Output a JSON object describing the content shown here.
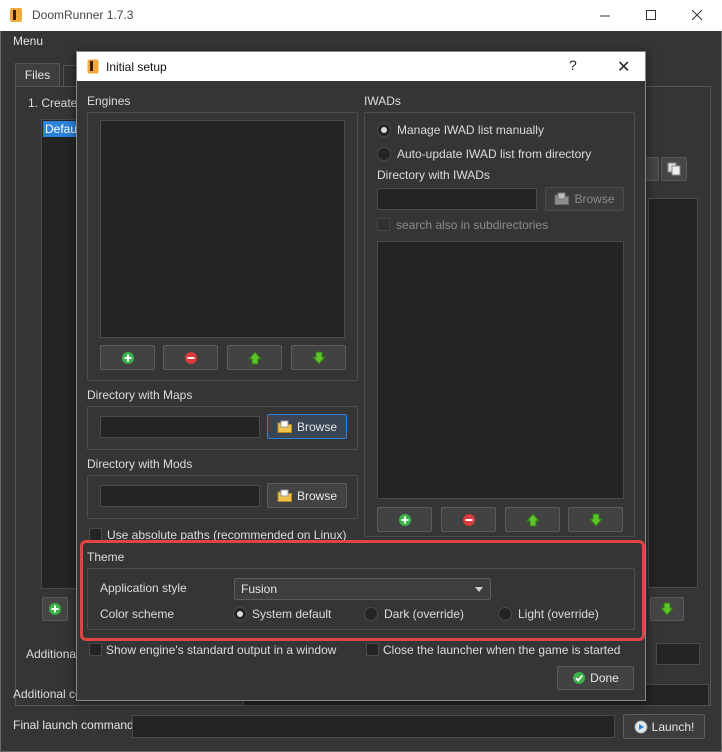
{
  "main_window": {
    "title": "DoomRunner 1.7.3",
    "menu_label": "Menu",
    "tabs": [
      {
        "label": "Files"
      },
      {
        "label": ""
      }
    ],
    "create_label": "1. Create",
    "preset_selected": "Defau",
    "additional_label_1": "Additional",
    "additional_label_2": "Additional co",
    "final_launch_label": "Final launch command",
    "final_launch_value": "",
    "launch_button": "Launch!"
  },
  "dialog": {
    "title": "Initial setup",
    "help_glyph": "?",
    "close_glyph": "✕",
    "engines": {
      "label": "Engines"
    },
    "maps_dir": {
      "label": "Directory with Maps",
      "value": "",
      "browse": "Browse"
    },
    "mods_dir": {
      "label": "Directory with Mods",
      "value": "",
      "browse": "Browse"
    },
    "absolute_paths": {
      "label": "Use absolute paths (recommended on Linux)",
      "checked": false
    },
    "iwads": {
      "label": "IWADs",
      "manual_label": "Manage IWAD list manually",
      "auto_label": "Auto-update IWAD list from directory",
      "dir_label": "Directory with IWADs",
      "dir_value": "",
      "browse": "Browse",
      "subdirs_label": "search also in subdirectories",
      "selected": "manual"
    },
    "theme": {
      "label": "Theme",
      "style_label": "Application style",
      "style_value": "Fusion",
      "scheme_label": "Color scheme",
      "schemes": [
        "System default",
        "Dark (override)",
        "Light (override)"
      ],
      "selected_scheme": "System default"
    },
    "show_output": {
      "label": "Show engine's standard output in a window",
      "checked": false
    },
    "close_launcher": {
      "label": "Close the launcher when the game is started",
      "checked": false
    },
    "done_button": "Done"
  },
  "colors": {
    "background": "#353535",
    "field": "#242424",
    "accent": "#2a82da",
    "highlight_outline": "#e04545",
    "add_green": "#3bb14a",
    "remove_red": "#d93a3a"
  }
}
